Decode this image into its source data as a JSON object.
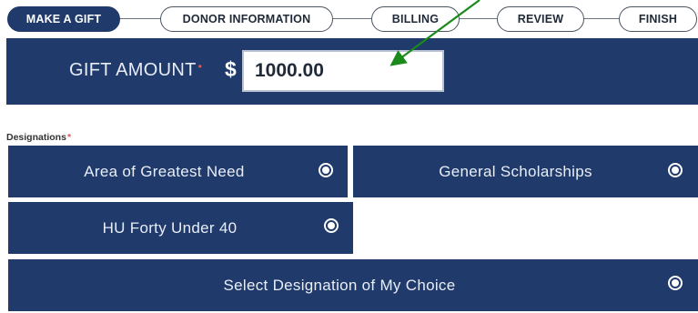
{
  "steps": [
    {
      "label": "MAKE A GIFT",
      "active": true
    },
    {
      "label": "DONOR INFORMATION",
      "active": false
    },
    {
      "label": "BILLING",
      "active": false
    },
    {
      "label": "REVIEW",
      "active": false
    },
    {
      "label": "FINISH",
      "active": false
    }
  ],
  "gift": {
    "label": "GIFT AMOUNT",
    "required_mark": "•",
    "currency": "$",
    "value": "1000.00"
  },
  "designations": {
    "label": "Designations",
    "required_mark": "*",
    "options": [
      {
        "label": "Area of Greatest Need"
      },
      {
        "label": "General Scholarships"
      },
      {
        "label": "HU Forty Under 40"
      },
      {
        "label": "Select Designation of My Choice"
      }
    ]
  },
  "colors": {
    "brand_navy": "#1f3a6b",
    "annotation_arrow": "#1a8a1a",
    "required": "#e05a5a"
  }
}
